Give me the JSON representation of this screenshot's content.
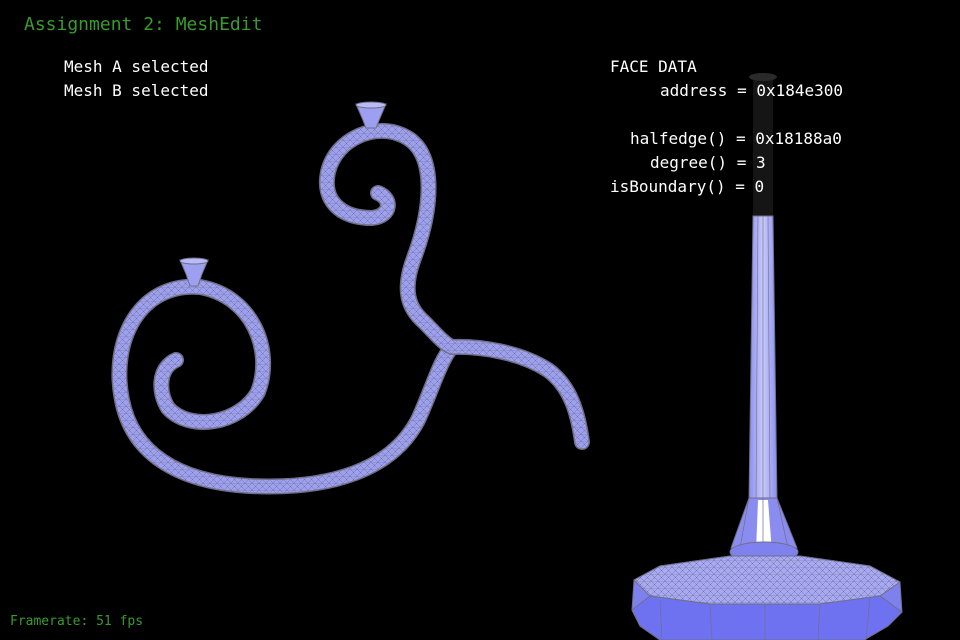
{
  "app": {
    "title": "Assignment 2: MeshEdit",
    "framerate_label": "Framerate: 51 fps"
  },
  "selection": {
    "mesh_a": "Mesh A selected",
    "mesh_b": "Mesh B selected"
  },
  "face_data": {
    "heading": "FACE DATA",
    "address": "address = 0x184e300",
    "halfedge": "halfedge() = 0x18188a0",
    "degree": "degree() = 3",
    "is_boundary": "isBoundary() = 0"
  },
  "colors": {
    "background": "#000000",
    "mesh_fill": "#9d9ff0",
    "mesh_highlight": "#6a6ef7",
    "wireframe": "#6f6f88",
    "title_green": "#3a9a2e",
    "label_white": "#ffffff"
  }
}
